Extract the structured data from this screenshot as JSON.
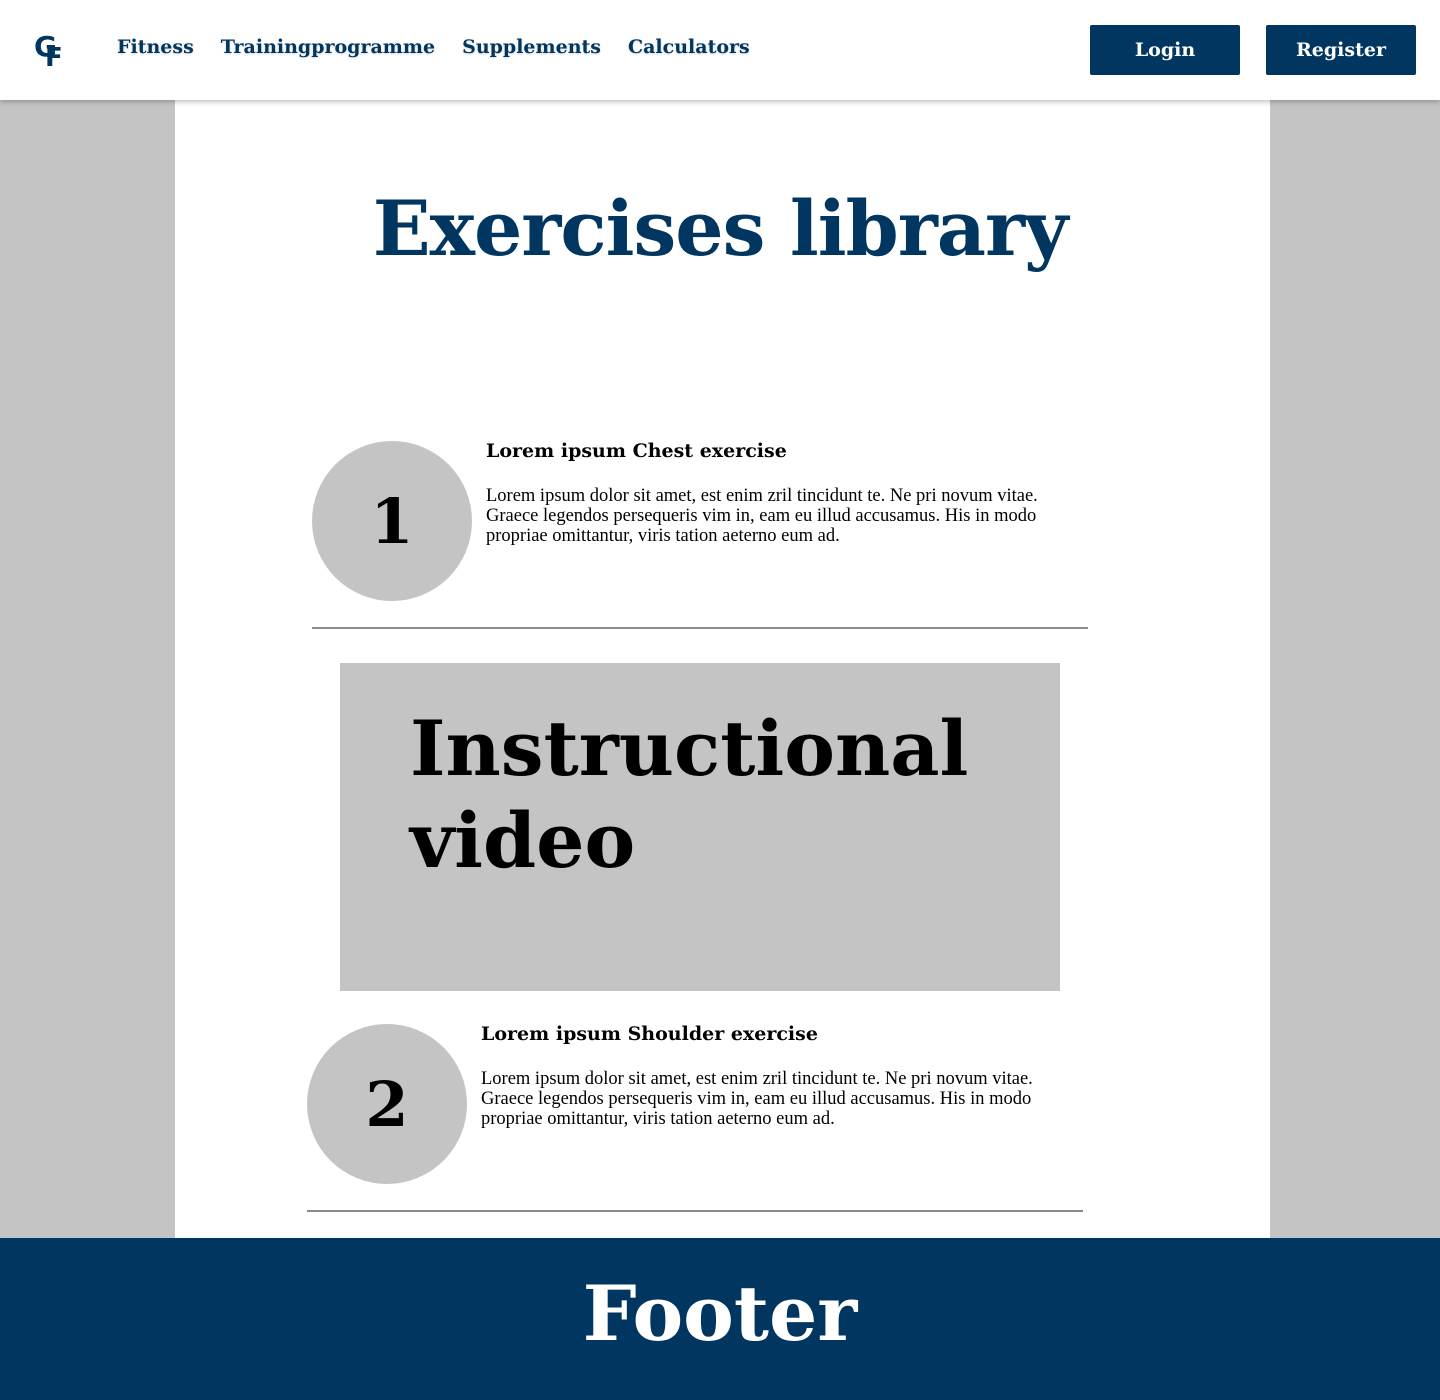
{
  "header": {
    "logo_text": "GF",
    "nav": [
      {
        "label": "Fitness"
      },
      {
        "label": "Trainingprogramme"
      },
      {
        "label": "Supplements"
      },
      {
        "label": "Calculators"
      }
    ],
    "login_label": "Login",
    "register_label": "Register"
  },
  "main": {
    "title": "Exercises library",
    "exercises": [
      {
        "number": "1",
        "title": "Lorem ipsum Chest exercise",
        "description": "Lorem ipsum dolor sit amet, est enim zril tincidunt te. Ne pri novum vitae. Graece legendos persequeris vim in, eam eu illud accusamus. His in modo propriae omittantur, viris tation aeterno eum ad."
      },
      {
        "number": "2",
        "title": "Lorem ipsum Shoulder exercise",
        "description": "Lorem ipsum dolor sit amet, est enim zril tincidunt te. Ne pri novum vitae. Graece legendos persequeris vim in, eam eu illud accusamus. His in modo propriae omittantur, viris tation aeterno eum ad."
      }
    ],
    "video_label": "Instructional video"
  },
  "footer": {
    "label": "Footer"
  },
  "colors": {
    "brand": "#003660",
    "placeholder": "#c4c4c4",
    "page_bg": "#c4c4c4"
  }
}
